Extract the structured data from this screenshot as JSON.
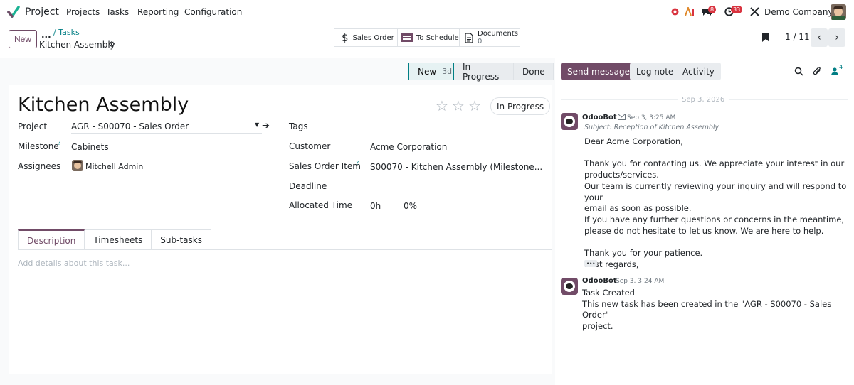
{
  "topbar": {
    "app_name": "Project",
    "menu": [
      "Projects",
      "Tasks",
      "Reporting",
      "Configuration"
    ],
    "chat_badge": "8",
    "activity_badge": "33",
    "company": "Demo Company"
  },
  "control_panel": {
    "new_label": "New",
    "breadcrumb_dots": "...",
    "breadcrumb_parent": "/ Tasks",
    "record_title": "Kitchen Assembly",
    "smart_buttons": {
      "sales_order": "Sales Order",
      "to_schedule": "To Schedule",
      "documents": "Documents",
      "documents_count": "0"
    },
    "pager": "1 / 11"
  },
  "status": {
    "stages": [
      "New",
      "In Progress",
      "Done"
    ],
    "new_duration": "3d",
    "active_stage": "New"
  },
  "form": {
    "title": "Kitchen Assembly",
    "state_label": "In Progress",
    "priority_stars": 0,
    "fields": {
      "project_label": "Project",
      "project_value": "AGR - S00070 - Sales Order",
      "milestone_label": "Milestone",
      "milestone_value": "Cabinets",
      "assignees_label": "Assignees",
      "assignees_value": "Mitchell Admin",
      "tags_label": "Tags",
      "customer_label": "Customer",
      "customer_value": "Acme Corporation",
      "so_item_label": "Sales Order Item",
      "so_item_value": "S00070 - Kitchen Assembly (Milestone...",
      "deadline_label": "Deadline",
      "allocated_label": "Allocated Time",
      "allocated_hours": "0h",
      "allocated_percent": "0%",
      "help_mark": "?"
    },
    "tabs": [
      "Description",
      "Timesheets",
      "Sub-tasks"
    ],
    "description_placeholder": "Add details about this task..."
  },
  "chatter": {
    "send_message": "Send message",
    "log_note": "Log note",
    "activity": "Activity",
    "followers_count": "4",
    "date_separator": "Sep 3, 2026",
    "messages": [
      {
        "author": "OdooBot",
        "time": "Sep 3, 3:25 AM",
        "subject": "Subject: Reception of Kitchen Assembly",
        "lines": [
          "Dear Acme Corporation,",
          "",
          "Thank you for contacting us. We appreciate your interest in our",
          "products/services.",
          "Our team is currently reviewing your inquiry and will respond to your",
          "email as soon as possible.",
          "If you have any further questions or concerns in the meantime,",
          "please do not hesitate to let us know. We are here to help.",
          "",
          "Thank you for your patience.",
          "Best regards,"
        ],
        "more": "•••"
      },
      {
        "author": "OdooBot",
        "time": "Sep 3, 3:24 AM",
        "lines": [
          "Task Created",
          "This new task has been created in the \"AGR - S00070 - Sales Order\"",
          "project."
        ]
      }
    ]
  },
  "colors": {
    "brand": "#714b67",
    "link": "#017e84",
    "badge": "#d9333f"
  }
}
